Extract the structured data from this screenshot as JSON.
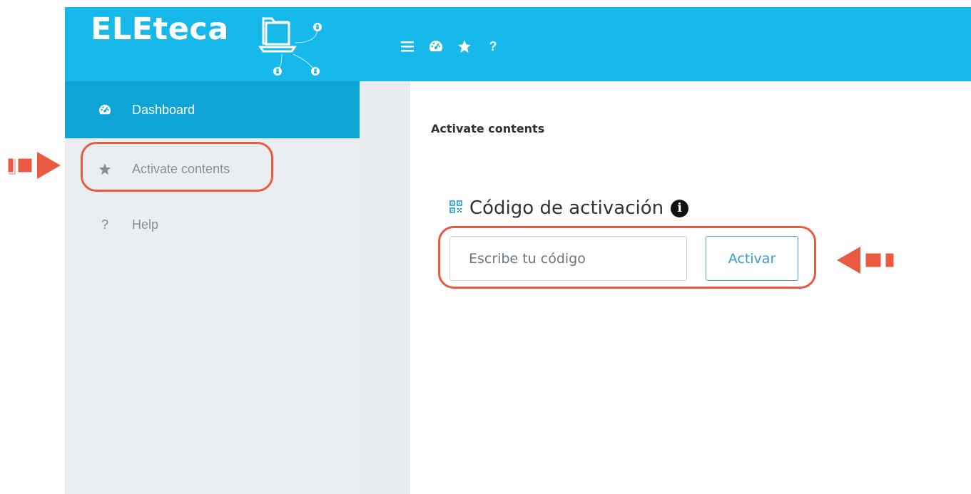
{
  "app": {
    "name": "ELEteca"
  },
  "topbar": {
    "icons": [
      "menu-icon",
      "dashboard-icon",
      "star-icon",
      "help-icon"
    ],
    "help_glyph": "?"
  },
  "sidebar": {
    "items": [
      {
        "label": "Dashboard",
        "icon": "dashboard-icon",
        "active": true
      },
      {
        "label": "Activate contents",
        "icon": "star-icon",
        "active": false,
        "highlighted": true
      },
      {
        "label": "Help",
        "icon": "help-icon",
        "active": false,
        "glyph": "?"
      }
    ]
  },
  "main": {
    "page_title": "Activate contents",
    "section_title": "Código de activación",
    "code_input": {
      "value": "",
      "placeholder": "Escribe tu código"
    },
    "activate_button": "Activar"
  },
  "colors": {
    "header": "#17b8ea",
    "sidebar_active": "#0ea5d6",
    "sidebar_bg": "#eaeef1",
    "annotation": "#ea5a41",
    "button_accent": "#3a9bd9"
  }
}
